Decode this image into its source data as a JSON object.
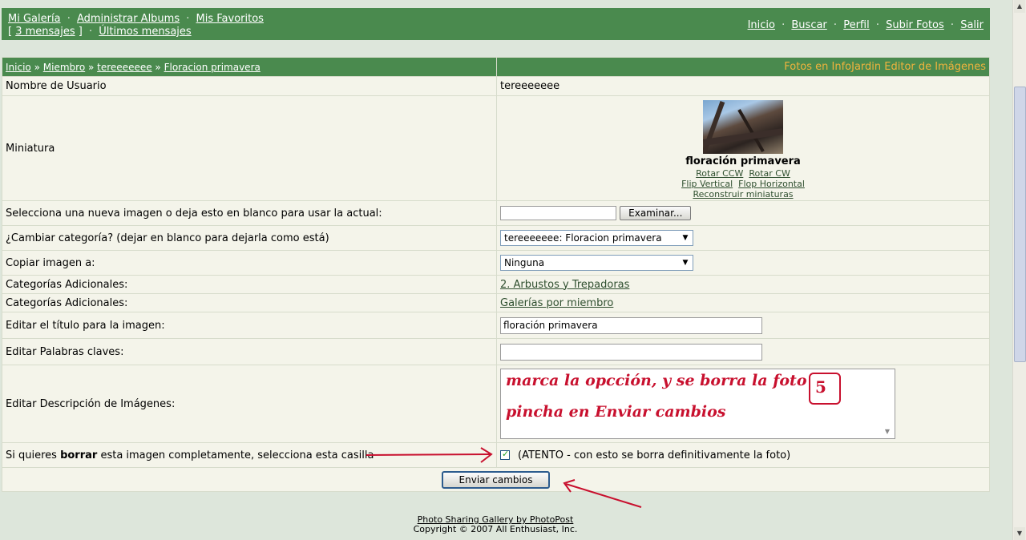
{
  "topnav": {
    "my_gallery": "Mi Galería",
    "manage_albums": "Administrar Albums",
    "favorites": "Mis Favoritos",
    "messages": "3 mensajes",
    "latest_messages": "Últimos mensajes",
    "home": "Inicio",
    "search": "Buscar",
    "profile": "Perfil",
    "upload": "Subir Fotos",
    "logout": "Salir",
    "dot_sep": "·",
    "bracket_open": "[",
    "bracket_close": "]"
  },
  "breadcrumb": {
    "items": [
      "Inicio",
      "Miembro",
      "tereeeeeee",
      "Floracion primavera"
    ],
    "separator": "»",
    "brand": "Fotos en InfoJardin Editor de Imágenes"
  },
  "form": {
    "username_label": "Nombre de Usuario",
    "username_value": "tereeeeeee",
    "thumbnail_label": "Miniatura",
    "thumbnail": {
      "caption": "floración primavera",
      "rotate_ccw": "Rotar CCW",
      "rotate_cw": "Rotar CW",
      "flip_vertical": "Flip Vertical",
      "flop_horizontal": "Flop Horizontal",
      "rebuild": "Reconstruir miniaturas"
    },
    "new_image_label": "Selecciona una nueva imagen o deja esto en blanco para usar la actual:",
    "browse_button": "Examinar...",
    "change_category_label": "¿Cambiar categoría? (dejar en blanco para dejarla como está)",
    "category_selected": "tereeeeeee: Floracion primavera",
    "copy_label": "Copiar imagen a:",
    "copy_selected": "Ninguna",
    "extra_cat_label_1": "Categorías Adicionales:",
    "extra_cat_value_1": "2. Arbustos y Trepadoras",
    "extra_cat_label_2": "Categorías Adicionales:",
    "extra_cat_value_2": "Galerías por miembro",
    "title_label": "Editar el título para la imagen:",
    "title_value": "floración primavera",
    "keywords_label": "Editar Palabras claves:",
    "keywords_value": "",
    "description_label": "Editar Descripción de Imágenes:",
    "delete_label_pre": "Si quieres ",
    "delete_label_bold": "borrar",
    "delete_label_post": " esta imagen completamente, selecciona esta casilla",
    "delete_note": "(ATENTO - con esto se borra definitivamente la foto)",
    "submit_button": "Enviar cambios"
  },
  "annotation": {
    "line1": "marca la opcción, y se borra la foto",
    "line2": "pincha en Enviar cambios",
    "step_number": "5",
    "color": "#c8102e"
  },
  "footer": {
    "credit": "Photo Sharing Gallery by PhotoPost",
    "copyright": "Copyright © 2007 All Enthusiast, Inc."
  },
  "colors": {
    "header_green": "#4a8a4e",
    "brand_orange": "#f0b33d",
    "row_bg": "#f4f4ea",
    "page_bg": "#dde6db"
  }
}
